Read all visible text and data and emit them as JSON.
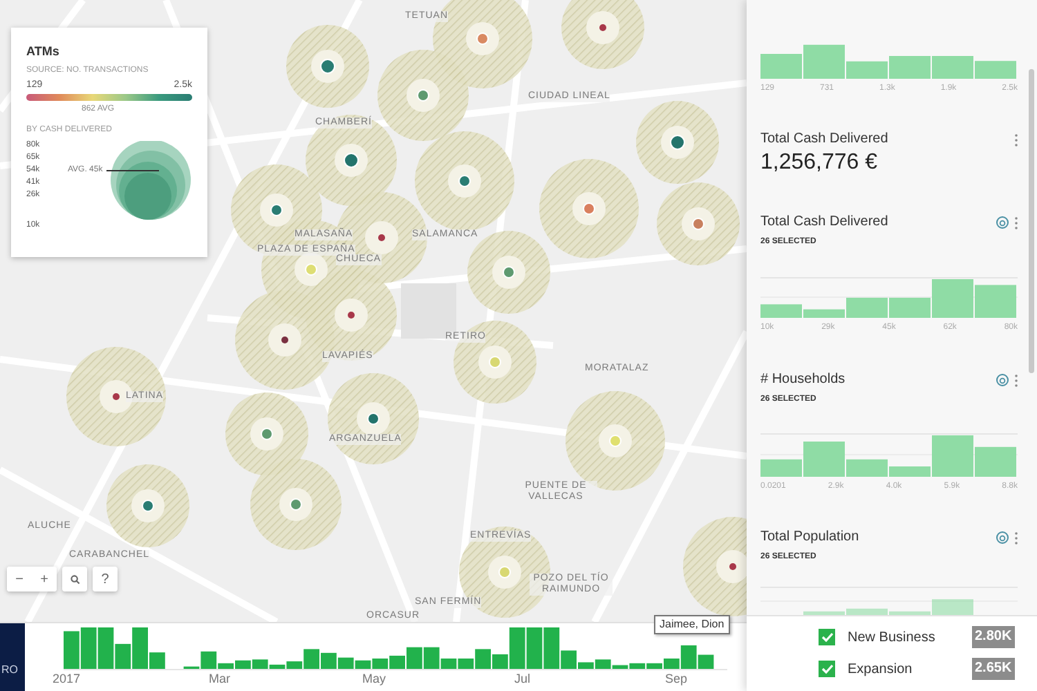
{
  "map": {
    "labels": [
      "TETUAN",
      "CIUDAD LINEAL",
      "CHAMBERÍ",
      "MALASAÑA",
      "SALAMANCA",
      "PLAZA DE ESPAÑA",
      "CHUECA",
      "LAVAPIÉS",
      "RETIRO",
      "MORATALAZ",
      "LATINA",
      "ARGANZUELA",
      "PUENTE DE VALLECAS",
      "ALUCHE",
      "ENTREVÍAS",
      "CARABANCHEL",
      "SAN FERMÍN",
      "POZO DEL TÍO RAIMUNDO",
      "ORCASUR"
    ],
    "markers": [
      {
        "color": "#2a7d73"
      },
      {
        "color": "#5e9a70"
      },
      {
        "color": "#d98a62"
      },
      {
        "color": "#a8384a"
      },
      {
        "color": "#23746c"
      },
      {
        "color": "#2a7d73"
      },
      {
        "color": "#23746c"
      },
      {
        "color": "#2a7d73"
      },
      {
        "color": "#d9805e"
      },
      {
        "color": "#c8805e"
      },
      {
        "color": "#a8384a"
      },
      {
        "color": "#dede74"
      },
      {
        "color": "#5e9a70"
      },
      {
        "color": "#a8384a"
      },
      {
        "color": "#7a3040"
      },
      {
        "color": "#d8d872"
      },
      {
        "color": "#23746c"
      },
      {
        "color": "#e0e070"
      },
      {
        "color": "#5e9a70"
      },
      {
        "color": "#5e9a70"
      },
      {
        "color": "#a8384a"
      },
      {
        "color": "#2a7d73"
      },
      {
        "color": "#d8d872"
      },
      {
        "color": "#a8384a"
      }
    ],
    "controls": [
      {
        "kind": "text",
        "label": "−"
      },
      {
        "kind": "text",
        "label": "+"
      },
      {
        "kind": "search"
      },
      {
        "kind": "text",
        "label": "?"
      }
    ]
  },
  "legend": {
    "title": "ATMs",
    "source": "SOURCE: NO. TRANSACTIONS",
    "min": "129",
    "max": "2.5k",
    "avg": "862 AVG",
    "size_title": "BY CASH DELIVERED",
    "size_labels": [
      "80k",
      "65k",
      "54k",
      "41k",
      "26k"
    ],
    "size_avg": "AVG. 45k",
    "size_min": "10k"
  },
  "widgets": [
    {
      "kind": "histogram",
      "axis_labels": [
        "129",
        "731",
        "1.3k",
        "1.9k",
        "2.5k"
      ]
    },
    {
      "kind": "formula",
      "title": "Total Cash Delivered",
      "value": "1,256,776 €"
    },
    {
      "kind": "histogram",
      "title": "Total Cash Delivered",
      "selected_count": "26 SELECTED",
      "axis_labels": [
        "10k",
        "29k",
        "45k",
        "62k",
        "80k"
      ]
    },
    {
      "kind": "histogram",
      "title": "# Households",
      "selected_count": "26 SELECTED",
      "axis_labels": [
        "0.0201",
        "2.9k",
        "4.0k",
        "5.9k",
        "8.8k"
      ]
    },
    {
      "kind": "histogram",
      "title": "Total Population",
      "selected_count": "26 SELECTED"
    }
  ],
  "timeline": {
    "axis_labels": [
      "2017",
      "Mar",
      "May",
      "Jul",
      "Sep"
    ],
    "tooltip": "Jaimee, Dion"
  },
  "side_tab": {
    "label": "RO"
  },
  "categories": [
    {
      "label": "New Business",
      "checked": true,
      "value": "2.80K"
    },
    {
      "label": "Expansion",
      "checked": true,
      "value": "2.65K"
    }
  ]
}
